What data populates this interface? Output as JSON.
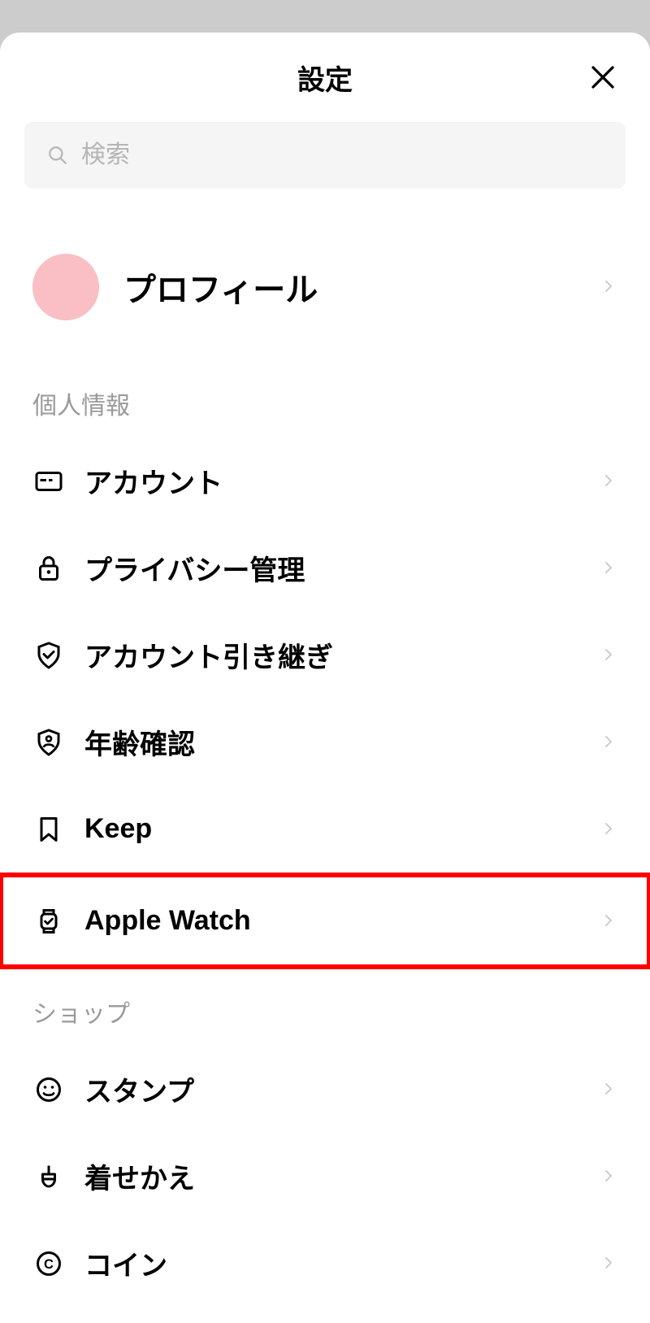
{
  "header": {
    "title": "設定"
  },
  "search": {
    "placeholder": "検索"
  },
  "profile": {
    "label": "プロフィール"
  },
  "sections": [
    {
      "title": "個人情報",
      "items": [
        {
          "id": "account",
          "label": "アカウント",
          "icon": "id-card"
        },
        {
          "id": "privacy",
          "label": "プライバシー管理",
          "icon": "lock"
        },
        {
          "id": "transfer",
          "label": "アカウント引き継ぎ",
          "icon": "shield-check"
        },
        {
          "id": "age-verify",
          "label": "年齢確認",
          "icon": "shield-person"
        },
        {
          "id": "keep",
          "label": "Keep",
          "icon": "bookmark"
        },
        {
          "id": "apple-watch",
          "label": "Apple Watch",
          "icon": "watch",
          "highlighted": true
        }
      ]
    },
    {
      "title": "ショップ",
      "items": [
        {
          "id": "stamps",
          "label": "スタンプ",
          "icon": "smile"
        },
        {
          "id": "themes",
          "label": "着せかえ",
          "icon": "paint"
        },
        {
          "id": "coins",
          "label": "コイン",
          "icon": "coin"
        }
      ]
    }
  ]
}
